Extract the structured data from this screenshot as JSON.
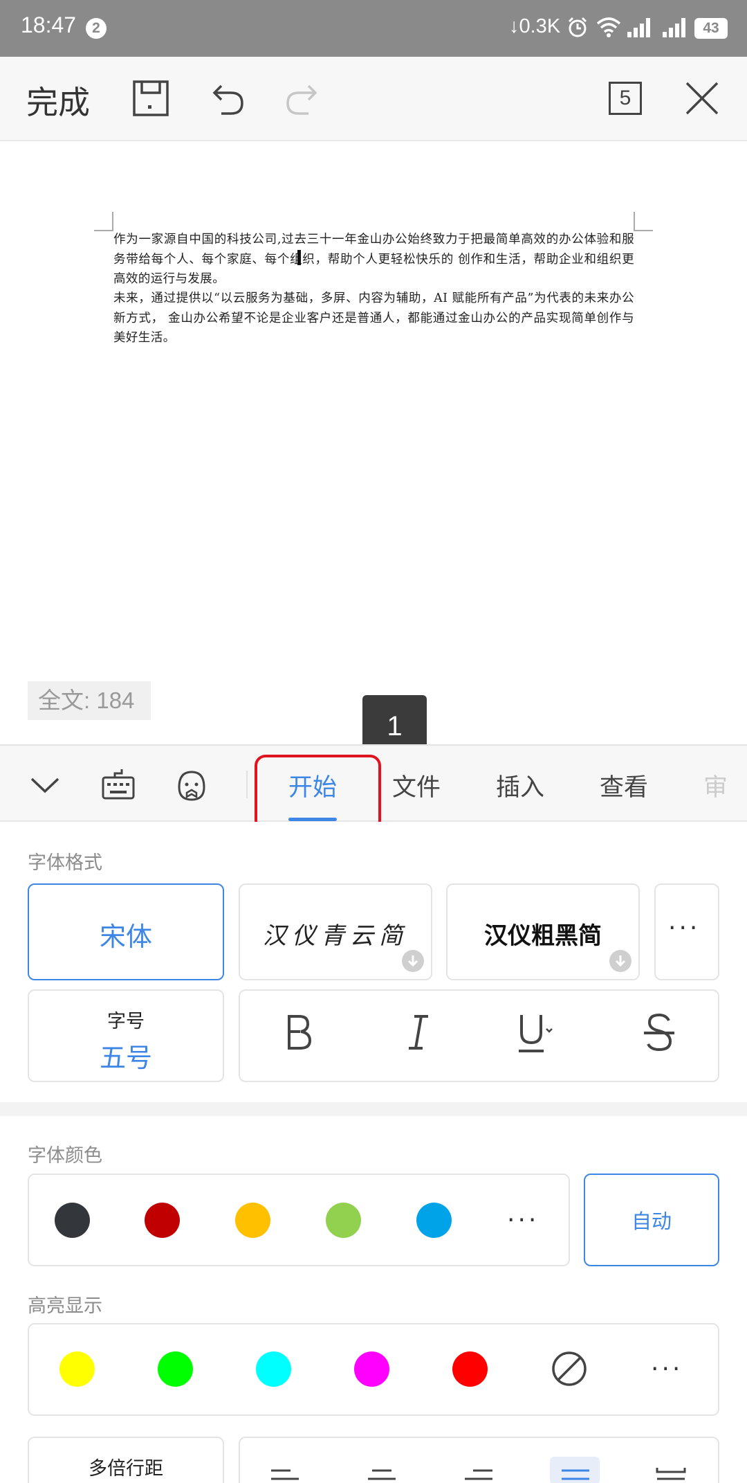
{
  "status_bar": {
    "time": "18:47",
    "notification_count": "2",
    "net_speed": "↓0.3K",
    "battery_level": "43",
    "icons": [
      "download-arrow-icon",
      "alarm-icon",
      "wifi-icon",
      "signal-icon",
      "signal-2-icon",
      "battery-icon"
    ]
  },
  "toolbar": {
    "done_label": "完成",
    "page_count": "5",
    "icons": [
      "save-icon",
      "undo-icon",
      "redo-icon",
      "page-count-icon",
      "close-icon"
    ]
  },
  "document": {
    "paragraphs": [
      "作为一家源自中国的科技公司,过去三十一年金山办公始终致力于把最简单高效的办公体验和服务带给每个人、每个家庭、每个组织，帮助个人更轻松快乐的 创作和生活，帮助企业和组织更高效的运行与发展。",
      "未来，通过提供以“以云服务为基础，多屏、内容为辅助，AI 赋能所有产品”为代表的未来办公新方式， 金山办公希望不论是企业客户还是普通人，都能通过金山办公的产品实现简单创作与美好生活。"
    ],
    "word_count": "全文: 184"
  },
  "tooltip": {
    "text": "1"
  },
  "tab_bar": {
    "icons": [
      "collapse-chevron-icon",
      "keyboard-icon",
      "assistant-face-icon"
    ],
    "tabs": [
      {
        "label": "开始",
        "active": true
      },
      {
        "label": "文件",
        "active": false
      },
      {
        "label": "插入",
        "active": false
      },
      {
        "label": "查看",
        "active": false
      },
      {
        "label": "审",
        "active": false
      }
    ]
  },
  "font_format": {
    "title": "字体格式",
    "fonts": [
      {
        "name": "宋体",
        "selected": true,
        "downloadable": false
      },
      {
        "name": "汉仪青云简",
        "selected": false,
        "downloadable": true
      },
      {
        "name": "汉仪粗黑简",
        "selected": false,
        "downloadable": true
      }
    ],
    "more_label": "···",
    "size_label": "字号",
    "size_value": "五号",
    "style_buttons": [
      "bold",
      "italic",
      "underline",
      "strikethrough"
    ]
  },
  "font_color": {
    "title": "字体颜色",
    "colors": [
      "#33363b",
      "#c00000",
      "#ffc000",
      "#92d050",
      "#00a2e8"
    ],
    "more_label": "···",
    "auto_label": "自动"
  },
  "highlight": {
    "title": "高亮显示",
    "colors": [
      "#ffff00",
      "#00ff00",
      "#00ffff",
      "#ff00ff",
      "#ff0000"
    ],
    "none_icon": "no-highlight-icon",
    "more_label": "···"
  },
  "paragraph": {
    "line_spacing_label": "多倍行距",
    "alignment_icons": [
      "align-left-icon",
      "align-center-icon",
      "align-right-icon",
      "align-justify-icon",
      "distributed-icon"
    ],
    "active_alignment": "align-justify-icon"
  },
  "theme": {
    "accent": "#3d86e6",
    "highlight_border": "#e0141e"
  }
}
